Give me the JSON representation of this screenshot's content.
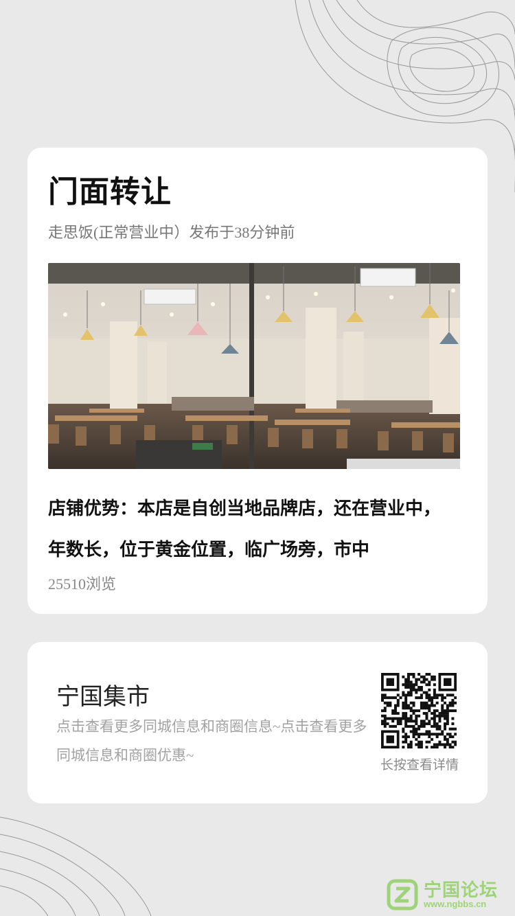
{
  "post": {
    "title": "门面转让",
    "meta": "走思饭(正常营业中）发布于38分钟前",
    "description": "店铺优势：本店是自创当地品牌店，还在营业中，年数长，位于黄金位置，临广场旁，市中",
    "views": "25510浏览",
    "image_icon": "restaurant-interior-photo"
  },
  "promo": {
    "title": "宁国集市",
    "description": "点击查看更多同城信息和商圈信息~点击查看更多同城信息和商圈优惠~",
    "qr_caption": "长按查看详情",
    "qr_icon": "qr-code-icon"
  },
  "brand": {
    "name": "宁国论坛",
    "domain": "www.ngbbs.cn",
    "icon": "ngbbs-logo-icon"
  },
  "colors": {
    "background": "#e9e9e9",
    "card": "#ffffff",
    "brand_green": "#9fd37a",
    "contour": "#555555"
  }
}
